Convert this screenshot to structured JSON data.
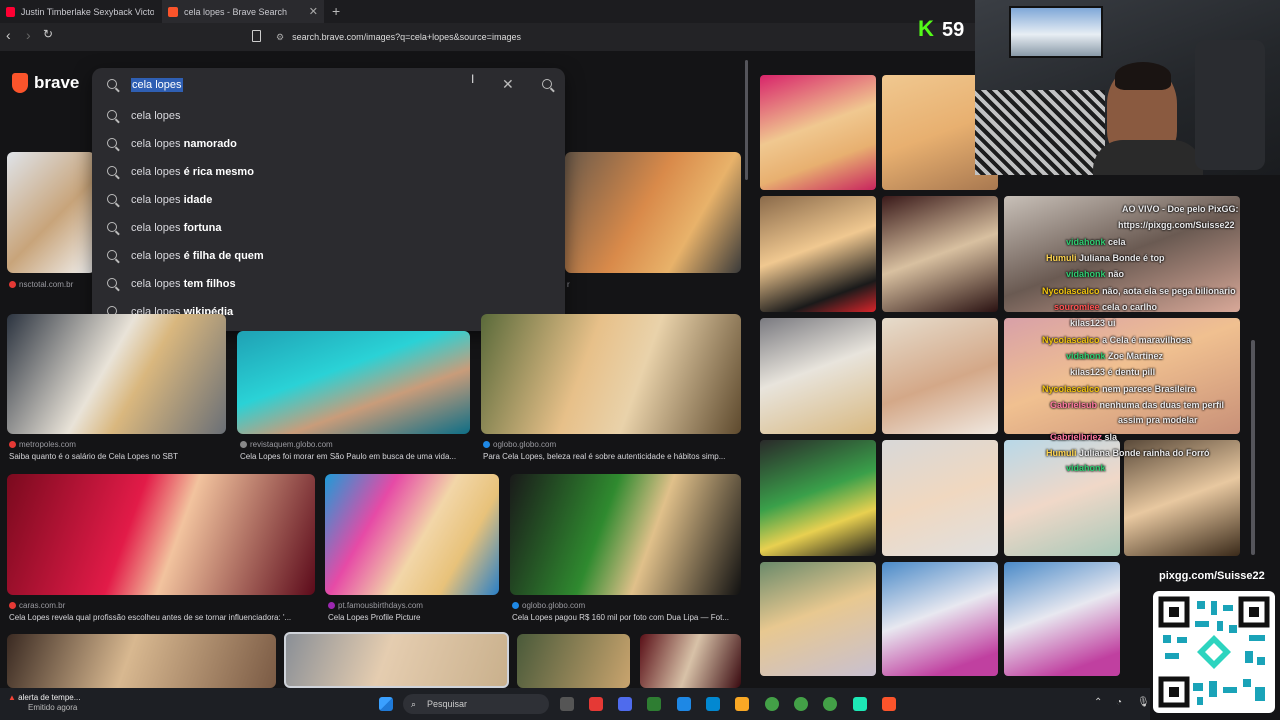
{
  "tabs": [
    {
      "label": "Justin Timberlake Sexyback Victoria's",
      "favicon_color": "#ff0033"
    },
    {
      "label": "cela lopes - Brave Search",
      "favicon_color": "#fb542b"
    }
  ],
  "address": {
    "url": "search.brave.com/images?q=cela+lopes&source=images"
  },
  "kick": {
    "letter": "K",
    "count": "59"
  },
  "brand": {
    "name": "brave"
  },
  "search": {
    "query": "cela lopes",
    "suggestions": [
      {
        "base": "cela lopes",
        "rest": ""
      },
      {
        "base": "cela lopes",
        "rest": "namorado"
      },
      {
        "base": "cela lopes",
        "rest": "é rica mesmo"
      },
      {
        "base": "cela lopes",
        "rest": "idade"
      },
      {
        "base": "cela lopes",
        "rest": "fortuna"
      },
      {
        "base": "cela lopes",
        "rest": "é filha de quem"
      },
      {
        "base": "cela lopes",
        "rest": "tem filhos"
      },
      {
        "base": "cela lopes",
        "rest": "wikipédia"
      }
    ]
  },
  "results": {
    "row1": [
      {
        "source": "nsctotal.com.br",
        "fav": "#e53935"
      },
      {
        "source": "r",
        "fav": "#444"
      }
    ],
    "row2": [
      {
        "source": "metropoles.com",
        "fav": "#e53935",
        "caption": "Saiba quanto é o salário de Cela Lopes no SBT"
      },
      {
        "source": "revistaquem.globo.com",
        "fav": "#888",
        "caption": "Cela Lopes foi morar em São Paulo em busca de uma vida..."
      },
      {
        "source": "oglobo.globo.com",
        "fav": "#1e88e5",
        "caption": "Para Cela Lopes, beleza real é sobre autenticidade e hábitos simp..."
      }
    ],
    "row3": [
      {
        "source": "caras.com.br",
        "fav": "#e53935",
        "caption": "Cela Lopes revela qual profissão escolheu antes de se tornar influenciadora: '..."
      },
      {
        "source": "pt.famousbirthdays.com",
        "fav": "#9c27b0",
        "caption": "Cela Lopes Profile Picture"
      },
      {
        "source": "oglobo.globo.com",
        "fav": "#1e88e5",
        "caption": "Cela Lopes pagou R$ 160 mil por foto com Dua Lipa — Fot..."
      }
    ]
  },
  "chat": [
    {
      "user": "",
      "text": "AO VIVO - Doe pelo PixGG:",
      "color": "#ffffff"
    },
    {
      "user": "",
      "text": "https://pixgg.com/Suisse22",
      "color": "#ffffff"
    },
    {
      "user": "vidahonk",
      "text": "cela",
      "color": "#2ecc71"
    },
    {
      "user": "Humuli",
      "text": "Juliana Bonde é top",
      "color": "#ffd54f"
    },
    {
      "user": "vidahonk",
      "text": "não",
      "color": "#2ecc71"
    },
    {
      "user": "Nycolascalco",
      "text": "não, aota ela se pega bilionario",
      "color": "#f1c40f"
    },
    {
      "user": "souromiee",
      "text": "cela o carlho",
      "color": "#ff5252"
    },
    {
      "user": "kilas123",
      "text": "ui",
      "color": "#ffffff"
    },
    {
      "user": "Nycolascalco",
      "text": "a Cela é maravilhosa",
      "color": "#f1c40f"
    },
    {
      "user": "vidahonk",
      "text": "Zoe Martinez",
      "color": "#2ecc71"
    },
    {
      "user": "kilas123",
      "text": "é dentu pill",
      "color": "#ffffff"
    },
    {
      "user": "Nycolascalco",
      "text": "nem parece Brasileira",
      "color": "#f1c40f"
    },
    {
      "user": "Gabrielsub",
      "text": "nenhuma das duas tem perfil",
      "color": "#ff7aa2"
    },
    {
      "user": "",
      "text": "assim pra modelar",
      "color": "#ffffff"
    },
    {
      "user": "Gabrielbriez",
      "text": "sla",
      "color": "#ff7aa2"
    },
    {
      "user": "Humuli",
      "text": "Juliana Bonde rainha do Forró",
      "color": "#ffd54f"
    },
    {
      "user": "vidahonk",
      "text": "",
      "color": "#2ecc71"
    }
  ],
  "overlay": {
    "pix_url": "pixgg.com/Suisse22"
  },
  "taskbar": {
    "search_placeholder": "Pesquisar",
    "notif_title": "alerta de tempe...",
    "notif_sub": "Emitido agora"
  }
}
